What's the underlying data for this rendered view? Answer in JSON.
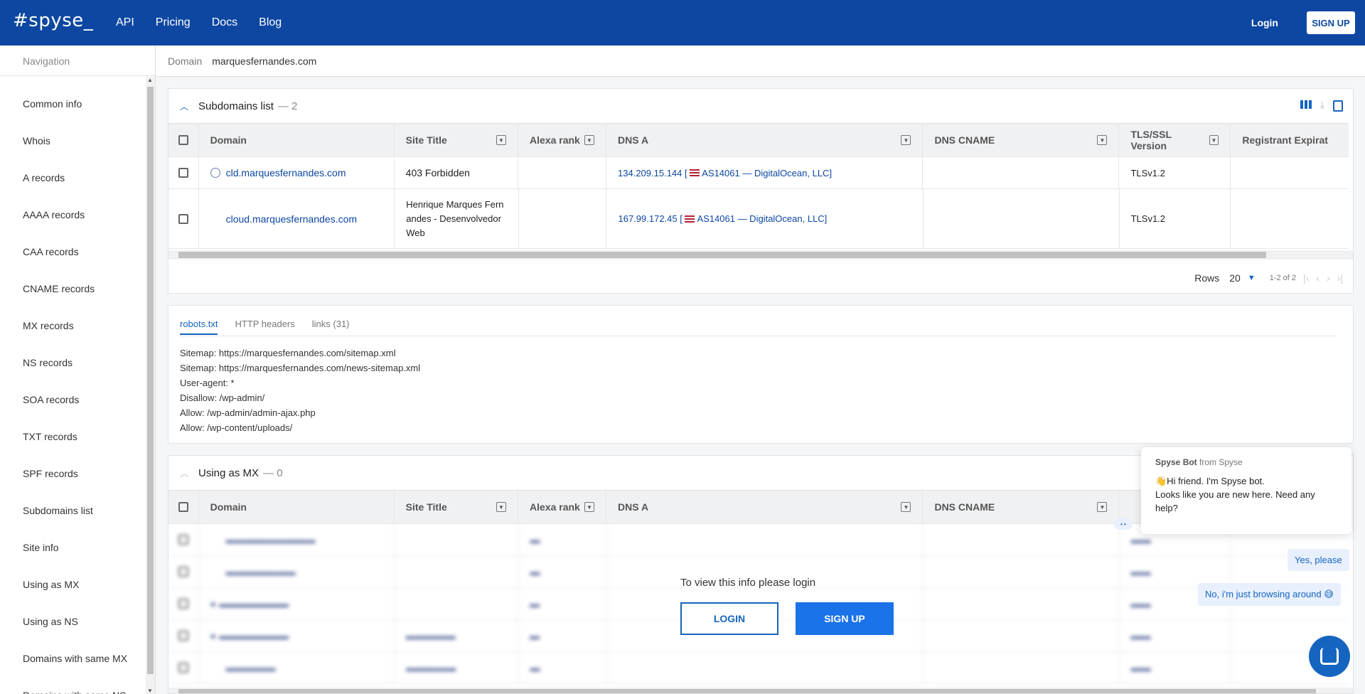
{
  "topbar": {
    "logo": "#spyse_",
    "nav": [
      "API",
      "Pricing",
      "Docs",
      "Blog"
    ],
    "login": "Login",
    "signup": "SIGN UP"
  },
  "sidebar": {
    "title": "Navigation",
    "items": [
      "Common info",
      "Whois",
      "A records",
      "AAAA records",
      "CAA records",
      "CNAME records",
      "MX records",
      "NS records",
      "SOA records",
      "TXT records",
      "SPF records",
      "Subdomains list",
      "Site info",
      "Using as MX",
      "Using as NS",
      "Domains with same MX",
      "Domains with same NS"
    ]
  },
  "breadcrumb": {
    "label": "Domain",
    "value": "marquesfernandes.com"
  },
  "subdomains": {
    "title": "Subdomains list",
    "count": "— 2",
    "columns": [
      "Domain",
      "Site Title",
      "Alexa rank",
      "DNS A",
      "DNS CNAME",
      "TLS/SSL Version",
      "Registrant Expirat"
    ],
    "rows": [
      {
        "domain": "cld.marquesfernandes.com",
        "title": "403 Forbidden",
        "alexa": "",
        "dns_ip": "134.209.15.144",
        "dns_as": "AS14061 — DigitalOcean, LLC]",
        "cname": "",
        "tls": "TLSv1.2",
        "exp": ""
      },
      {
        "domain": "cloud.marquesfernandes.com",
        "title": "Henrique Marques Fernandes - Desenvolvedor Web",
        "alexa": "",
        "dns_ip": "167.99.172.45",
        "dns_as": "AS14061 — DigitalOcean, LLC]",
        "cname": "",
        "tls": "TLSv1.2",
        "exp": ""
      }
    ],
    "pager": {
      "rows_label": "Rows",
      "rows_value": "20",
      "range": "1-2 of 2"
    }
  },
  "siteinfo": {
    "tabs": [
      "robots.txt",
      "HTTP headers",
      "links (31)"
    ],
    "robots_lines": [
      "Sitemap: https://marquesfernandes.com/sitemap.xml",
      "Sitemap: https://marquesfernandes.com/news-sitemap.xml",
      "User-agent: *",
      "Disallow: /wp-admin/",
      "Allow: /wp-admin/admin-ajax.php",
      "Allow: /wp-content/uploads/"
    ]
  },
  "mx": {
    "title": "Using as MX",
    "count": "— 0",
    "columns": [
      "Domain",
      "Site Title",
      "Alexa rank",
      "DNS A",
      "DNS CNAME"
    ],
    "overlay_text": "To view this info please login",
    "login_btn": "LOGIN",
    "signup_btn": "SIGN UP"
  },
  "chat": {
    "sender": "Spyse Bot",
    "from": "from Spyse",
    "message_line1": "👋Hi friend. I'm Spyse bot.",
    "message_line2": "Looks like you are new here. Need any help?",
    "reply1": "Yes, please",
    "reply2": "No, i'm just browsing around 😅"
  },
  "colors": {
    "brand": "#0d47a1",
    "accent": "#1a73e8"
  }
}
